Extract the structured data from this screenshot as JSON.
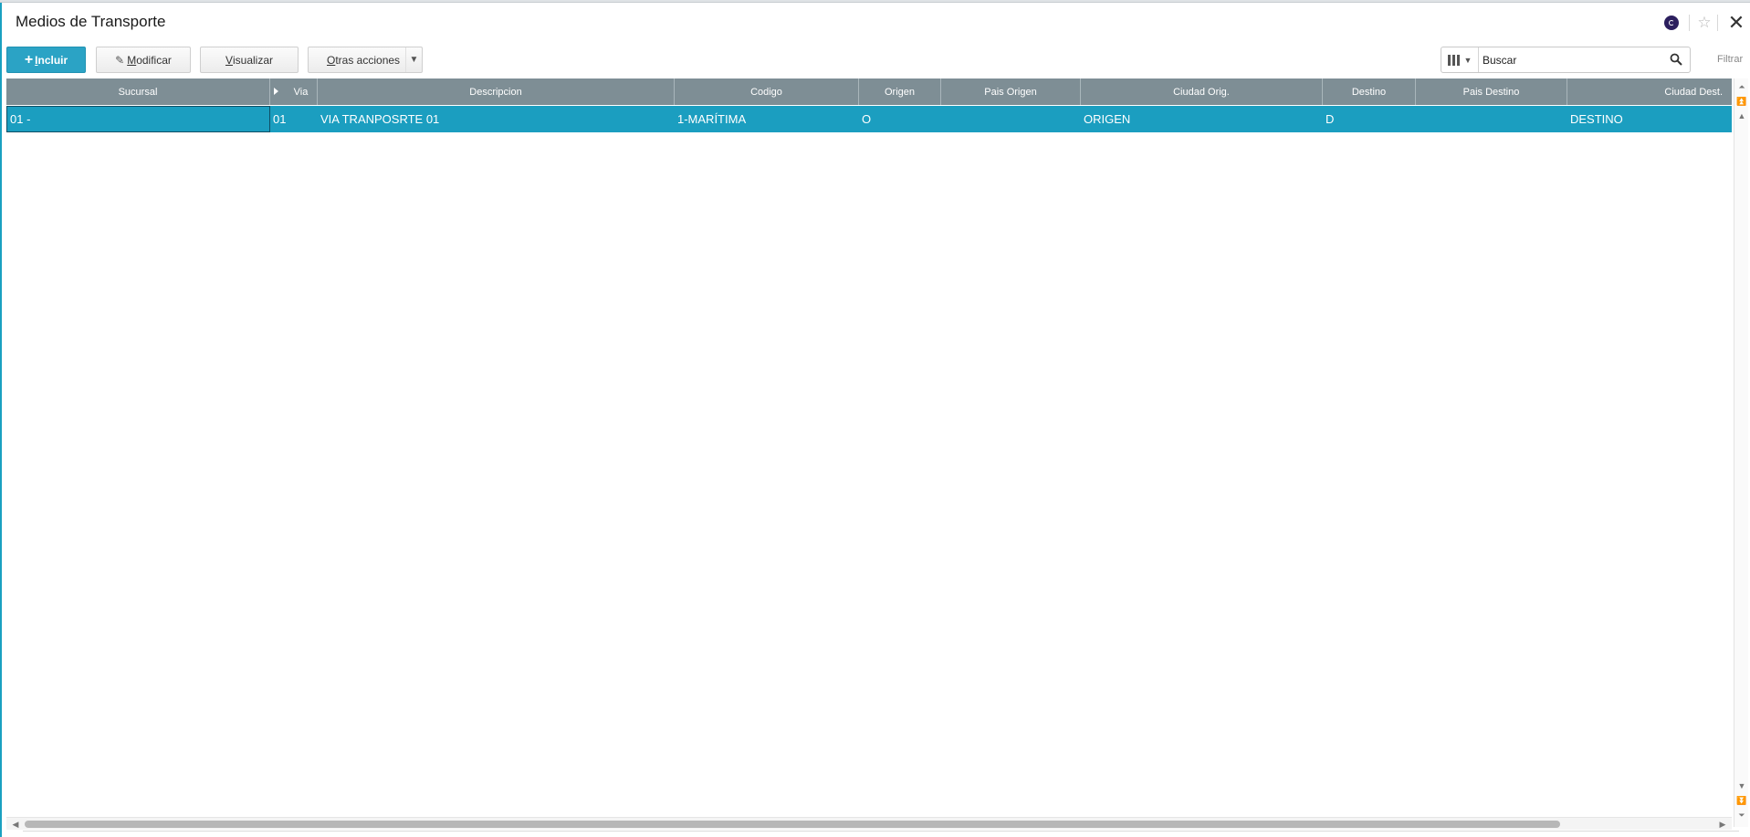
{
  "window": {
    "title": "Medios de Transporte"
  },
  "header_icons": {
    "profile": "user-circle-icon",
    "favorite": "star-icon",
    "close": "close-icon"
  },
  "toolbar": {
    "incluir": {
      "plus": "+",
      "first": "I",
      "rest": "ncluir"
    },
    "modificar": {
      "first": "M",
      "rest": "odificar"
    },
    "visualizar": {
      "first": "V",
      "rest": "isualizar"
    },
    "otras": {
      "first": "O",
      "rest": "tras acciones"
    }
  },
  "search": {
    "placeholder": "Buscar"
  },
  "filter_label": "Filtrar",
  "table": {
    "headers": [
      "Sucursal",
      "Via",
      "Descripcion",
      "Codigo",
      "Origen",
      "Pais Origen",
      "Ciudad Orig.",
      "Destino",
      "Pais Destino",
      "Ciudad Dest."
    ],
    "rows": [
      [
        "01  -",
        "01",
        "VIA TRANPOSRTE 01",
        "1-MARÍTIMA",
        "O",
        "",
        "ORIGEN",
        "D",
        "",
        "DESTINO"
      ]
    ]
  },
  "colors": {
    "accent": "#1b9ec0",
    "header_bg": "#7e8e95",
    "primary_button": "#2ba3c5"
  }
}
